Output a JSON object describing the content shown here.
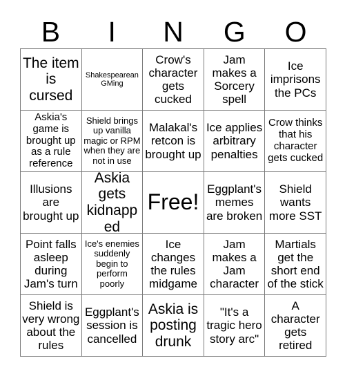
{
  "header": {
    "letters": [
      "B",
      "I",
      "N",
      "G",
      "O"
    ]
  },
  "grid": {
    "columns": 5,
    "rows": 5,
    "cells": [
      {
        "text": "The item is cursed",
        "size": "lg"
      },
      {
        "text": "Shakespearean GMing",
        "size": "xxs"
      },
      {
        "text": "Crow's character gets cucked",
        "size": "md"
      },
      {
        "text": "Jam makes a Sorcery spell",
        "size": "md"
      },
      {
        "text": "Ice imprisons the PCs",
        "size": "md"
      },
      {
        "text": "Askia's game is brought up as a rule reference",
        "size": "sm"
      },
      {
        "text": "Shield brings up vanilla magic or RPM when they are not in use",
        "size": "xs"
      },
      {
        "text": "Malakal's retcon is brought up",
        "size": "md"
      },
      {
        "text": "Ice applies arbitrary penalties",
        "size": "md"
      },
      {
        "text": "Crow thinks that his character gets cucked",
        "size": "sm"
      },
      {
        "text": "Illusions are brought up",
        "size": "md"
      },
      {
        "text": "Askia gets kidnapped",
        "size": "lg"
      },
      {
        "text": "Free!",
        "size": "xl"
      },
      {
        "text": "Eggplant's memes are broken",
        "size": "md"
      },
      {
        "text": "Shield wants more SST",
        "size": "md"
      },
      {
        "text": "Point falls asleep during Jam's turn",
        "size": "md"
      },
      {
        "text": "Ice's enemies suddenly begin to perform poorly",
        "size": "xs"
      },
      {
        "text": "Ice changes the rules midgame",
        "size": "md"
      },
      {
        "text": "Jam makes a Jam character",
        "size": "md"
      },
      {
        "text": "Martials get the short end of the stick",
        "size": "md"
      },
      {
        "text": "Shield is very wrong about the rules",
        "size": "md"
      },
      {
        "text": "Eggplant's session is cancelled",
        "size": "md"
      },
      {
        "text": "Askia is posting drunk",
        "size": "lg"
      },
      {
        "text": "\"It's a tragic hero story arc\"",
        "size": "md"
      },
      {
        "text": "A character gets retired",
        "size": "md"
      }
    ]
  },
  "colors": {
    "background": "#ffffff",
    "text": "#000000",
    "border": "#7a7a7a"
  }
}
